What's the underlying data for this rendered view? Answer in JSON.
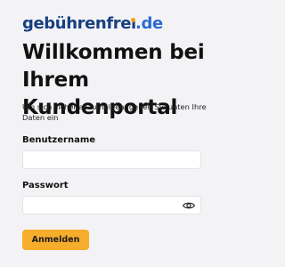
{
  "brand": {
    "logo_part1": "gebühren",
    "logo_part2": "fre",
    "logo_i": "ı",
    "logo_part3": ".de",
    "primary_color": "#163f7f",
    "accent_color": "#f0a314",
    "secondary_color": "#2b6bd0"
  },
  "header": {
    "title_line1": "Willkommen bei",
    "title_line2": "Ihrem Kundenportal",
    "subtitle": "Um sich sicher anzumelden, geben Sie unten Ihre Daten ein"
  },
  "form": {
    "username_label": "Benutzername",
    "username_value": "",
    "username_placeholder": "",
    "password_label": "Passwort",
    "password_value": "",
    "password_placeholder": "",
    "show_password_icon": "eye-icon",
    "submit_label": "Anmelden",
    "submit_color": "#f6ad2b"
  }
}
